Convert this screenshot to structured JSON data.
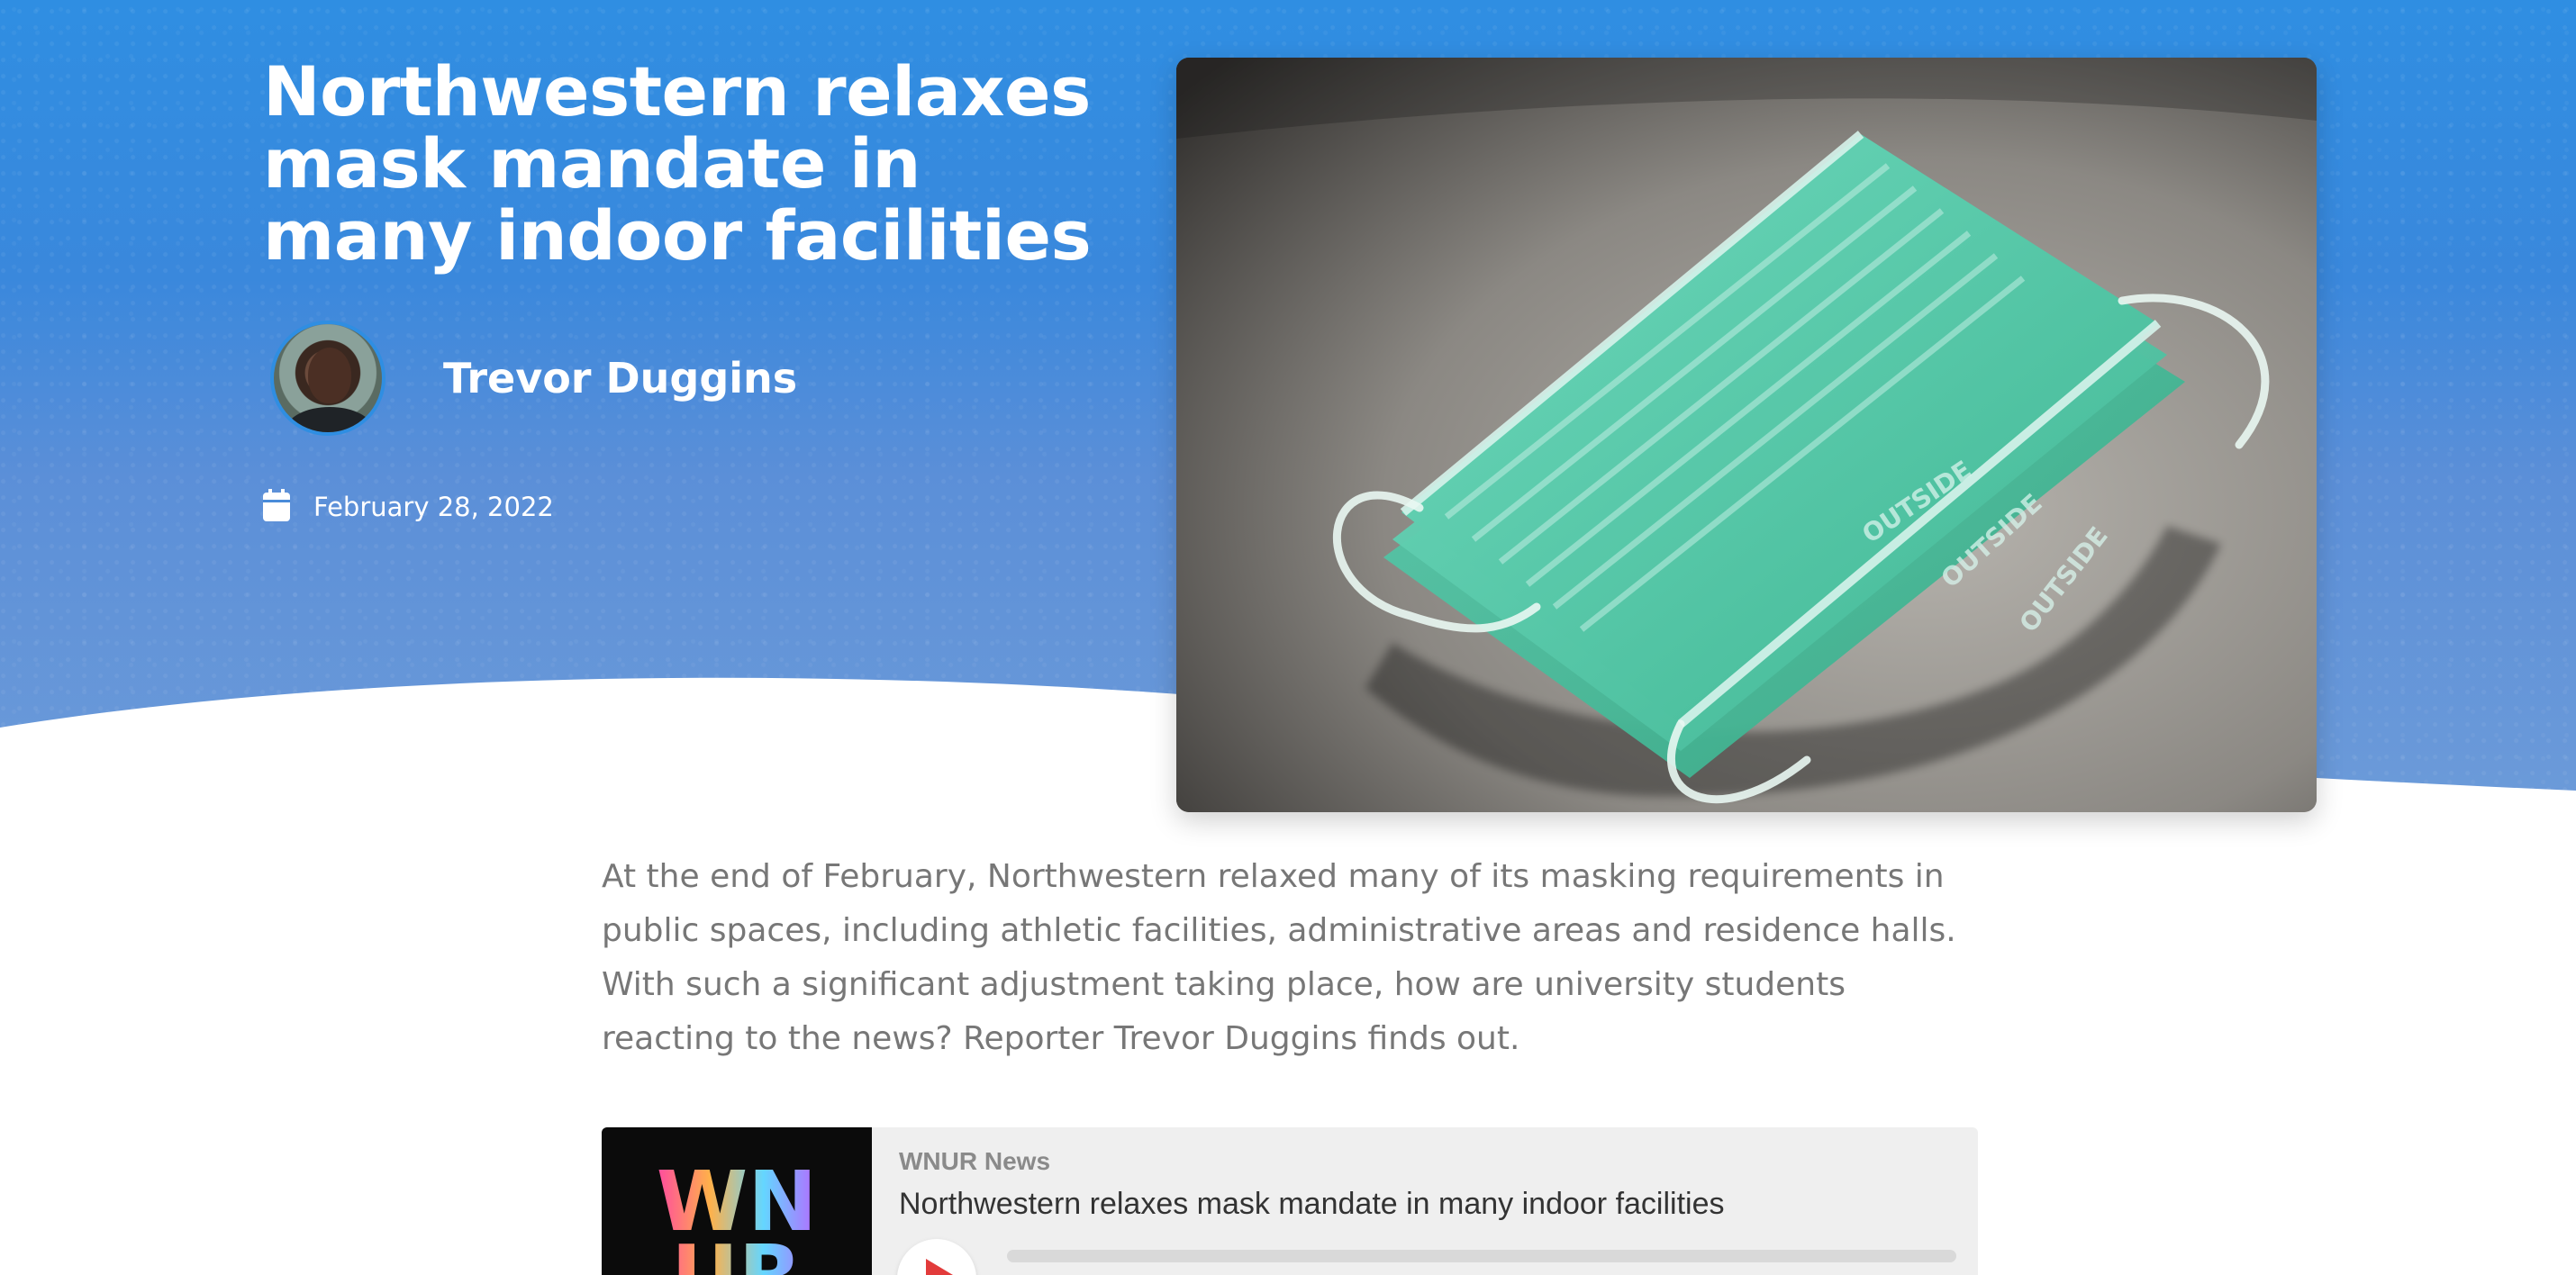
{
  "article": {
    "title": "Northwestern relaxes mask mandate in many indoor facilities",
    "author": {
      "name": "Trevor Duggins",
      "avatar_icon": "author-avatar"
    },
    "date": "February 28, 2022",
    "body": "At the end of February, Northwestern relaxed many of its masking requirements in public spaces, including athletic facilities, administrative areas and residence halls. With such a significant adjustment taking place, how are university students reacting to the news? Reporter Trevor Duggins finds out."
  },
  "hero_image": {
    "subject": "surgical masks on table",
    "imprint_text": "OUTSIDE"
  },
  "player": {
    "source": "WNUR News",
    "title": "Northwestern relaxes mask mandate in many indoor facilities",
    "logo_text": "WN\nUR",
    "play_icon": "play-icon",
    "progress": 0
  },
  "colors": {
    "hero_blue": "#2f8ee2",
    "body_text": "#777777",
    "player_bg": "#efefef",
    "mask_green": "#5ec9ad"
  }
}
